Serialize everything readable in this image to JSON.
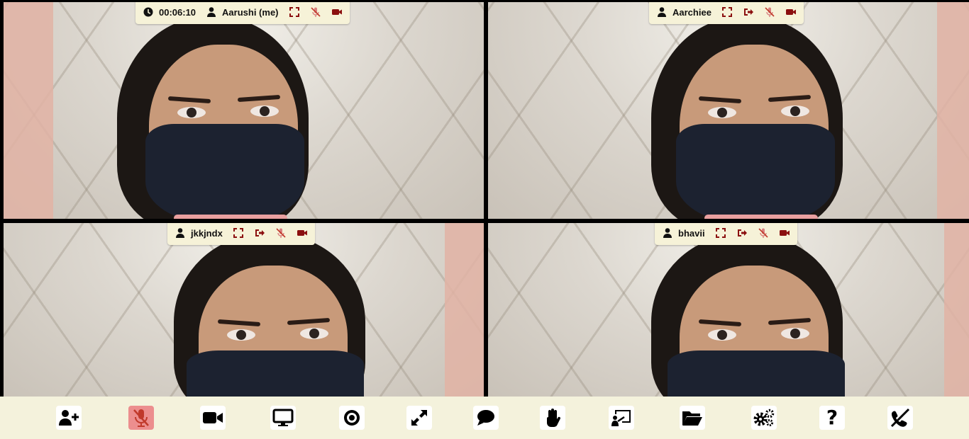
{
  "tiles": [
    {
      "participant": "Aarushi (me)",
      "timer": "00:06:10",
      "is_me": true
    },
    {
      "participant": "Aarchiee"
    },
    {
      "participant": "jkkjndx"
    },
    {
      "participant": "bhavii"
    }
  ],
  "icons": {
    "timer": "clock-icon",
    "user": "user-icon",
    "fullscreen": "fullscreen-icon",
    "kick": "sign-out-icon",
    "mic": "microphone-muted-icon",
    "video": "video-camera-icon"
  },
  "toolbar": [
    "add-participant-icon",
    "microphone-muted-icon",
    "video-camera-icon",
    "screen-share-icon",
    "record-icon",
    "fullscreen-expand-icon",
    "chat-icon",
    "raise-hand-icon",
    "whiteboard-icon",
    "file-folder-icon",
    "settings-icon",
    "help-icon",
    "leave-call-icon"
  ],
  "colors": {
    "bar_bg": "#f6f2d8",
    "toolbar_bg": "#f4f2dc",
    "accent_red": "#8b0f0f",
    "muted_btn": "#ec8e8e",
    "help_q": "?"
  }
}
